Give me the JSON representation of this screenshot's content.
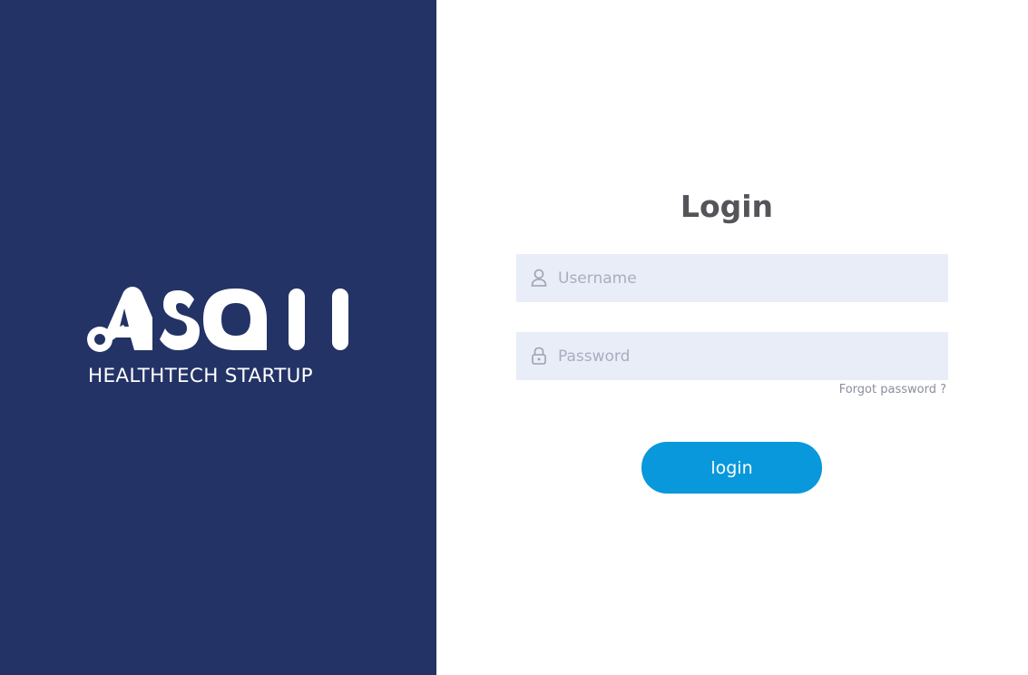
{
  "brand": {
    "logo_text": "ASQII",
    "tagline": "HEALTHTECH STARTUP"
  },
  "login": {
    "title": "Login",
    "username": {
      "placeholder": "Username",
      "value": "",
      "icon": "user-icon"
    },
    "password": {
      "placeholder": "Password",
      "value": "",
      "icon": "lock-icon"
    },
    "forgot_label": "Forgot password ?",
    "submit_label": "login"
  },
  "colors": {
    "brand_panel": "#233366",
    "field_background": "#e9edf8",
    "button": "#0898db",
    "title_text": "#555559"
  }
}
